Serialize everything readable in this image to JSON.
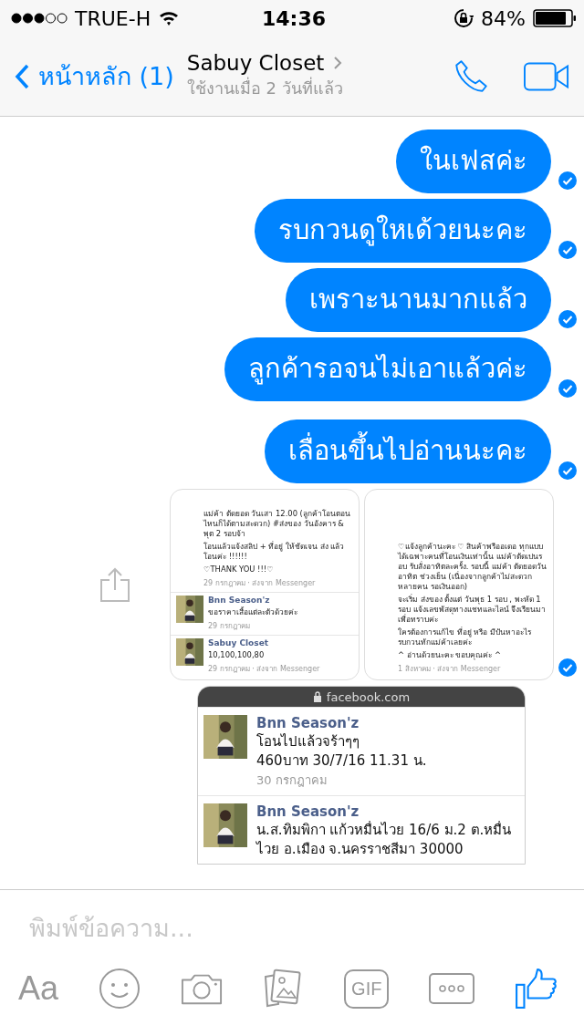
{
  "status_bar": {
    "carrier": "TRUE-H",
    "time": "14:36",
    "battery": "84%"
  },
  "header": {
    "back_label": "หน้าหลัก (1)",
    "title": "Sabuy Closet",
    "subtitle": "ใช้งานเมื่อ 2 วันที่แล้ว"
  },
  "messages": [
    {
      "kind": "text",
      "text": "ในเฟสค่ะ",
      "seen": true
    },
    {
      "kind": "text",
      "text": "รบกวนดูใหเด้วยนะคะ",
      "seen": true
    },
    {
      "kind": "text",
      "text": "เพราะนานมากแล้ว",
      "seen": true
    },
    {
      "kind": "text",
      "text": "ลูกค้ารอจนไม่เอาแล้วค่ะ",
      "seen": true
    },
    {
      "kind": "text",
      "text": "เลื่อนขึ้นไปอ่านนะคะ",
      "seen": true
    },
    {
      "kind": "screenshots",
      "seen": true,
      "shots": [
        {
          "posts": [
            {
              "avatar": false,
              "paragraphs": [
                "แม่ค้า ตัดยอด วันเสา 12.00 (ลูกค้าโอนตอนไหนก็ได้ตามสะดวก) #ส่งของ วันอังคาร & พุต 2 รอบจ้า",
                "โอนแล้วแจ้งสลิป + ที่อยู่ ให้ชัดเจน ส่ง แล้วโอนค่ะ !!!!!!",
                "♡THANK YOU !!!♡"
              ],
              "date": "29 กรกฎาคม · ส่งจาก Messenger"
            },
            {
              "avatar": true,
              "author": "Bnn Season'z",
              "paragraphs": [
                "ขอราคาเสื้อแต่ละตัวด้วยค่ะ"
              ],
              "date": "29 กรกฎาคม"
            },
            {
              "avatar": true,
              "author": "Sabuy Closet",
              "paragraphs": [
                "10,100,100,80"
              ],
              "date": "29 กรกฎาคม · ส่งจาก Messenger"
            }
          ]
        },
        {
          "posts": [
            {
              "avatar": false,
              "paragraphs": [
                "♡แจ้งลูกค้านะคะ ♡ สินค้าพรีออเดอ ทุกแบบ ได้เฉพาะคนที่โอนเงินเท่านั้น แม่ค้าตัดเปนรอบ รับสั่งอาทิตละครั้ง. รอบนี้ แม่ค้า ตัดยอดวันอาทิต ช่วงเย็น (เนื่องจากลูกค้าไม่สะดวกหลายคน รอเงินออก)",
                "จะเริ่ม ส่งของ ตั้งแต่ วันพุธ 1 รอบ , พะหัด 1 รอบ แจ้งเลขพัสดุทางแชทและไลน์ จึงเรียนมาเพื่อทราบค่ะ",
                "ใครต้องการแก้ไข ที่อยู่ หรือ มีปันหาอะไรรบกวนทักแม่ค้าเลยค่ะ",
                "^ อ่านด้วยนะคะ ขอบคุณค่ะ ^"
              ],
              "date": "1 สิงหาคม · ส่งจาก Messenger"
            }
          ]
        }
      ]
    },
    {
      "kind": "browser_screenshot",
      "seen": false,
      "url": "facebook.com",
      "posts": [
        {
          "avatar": true,
          "author": "Bnn Season'z",
          "paragraphs": [
            "โอนไปแล้วจร้าๆๆ",
            "460บาท 30/7/16 11.31 น."
          ],
          "date": "30 กรกฎาคม"
        },
        {
          "avatar": true,
          "author": "Bnn Season'z",
          "paragraphs": [
            "น.ส.ทิมพิกา แก้วหมื่นไวย 16/6 ม.2 ต.หมื่น",
            "ไวย อ.เมือง จ.นครราชสีมา 30000"
          ]
        }
      ]
    }
  ],
  "composer": {
    "placeholder": "พิมพ์ข้อความ...",
    "text_button": "Aa",
    "gif_button": "GIF"
  }
}
